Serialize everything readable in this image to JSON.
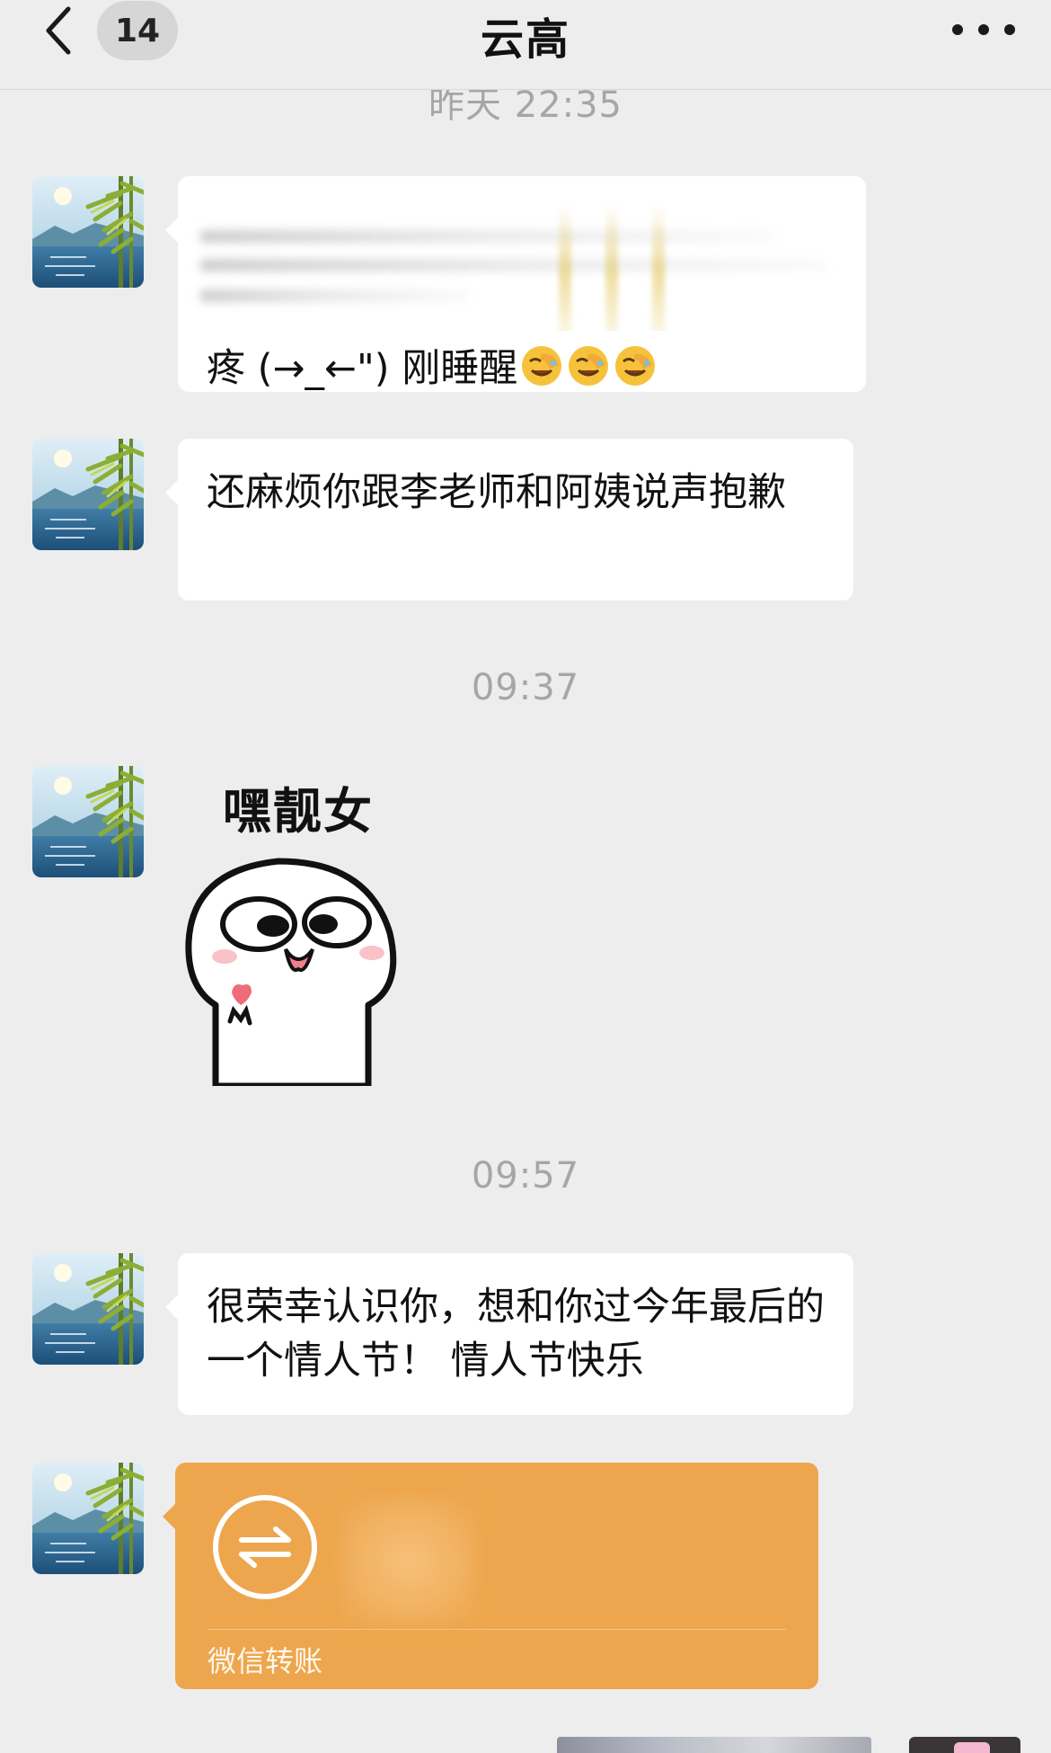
{
  "header": {
    "back_icon": "chevron-left-icon",
    "unread_count": "14",
    "title": "云高",
    "more_icon": "ellipsis-icon"
  },
  "timestamps": {
    "yesterday": "昨天 22:35",
    "t1": "09:37",
    "t2": "09:57"
  },
  "messages": {
    "m1_text": "疼 (→_←\") 刚睡醒",
    "m1_emoji": "facepalm-laughing-emoji",
    "m2_text": "还麻烦你跟李老师和阿姨说声抱歉",
    "sticker_text": "嘿靓女",
    "m3_text": "很荣幸认识你，想和你过今年最后的一个情人节！ 情人节快乐",
    "transfer_label": "微信转账",
    "transfer_icon": "transfer-arrows-icon"
  },
  "colors": {
    "background": "#ededed",
    "bubble": "#ffffff",
    "transfer": "#eda64d",
    "timestamp": "#a6a6a6"
  }
}
